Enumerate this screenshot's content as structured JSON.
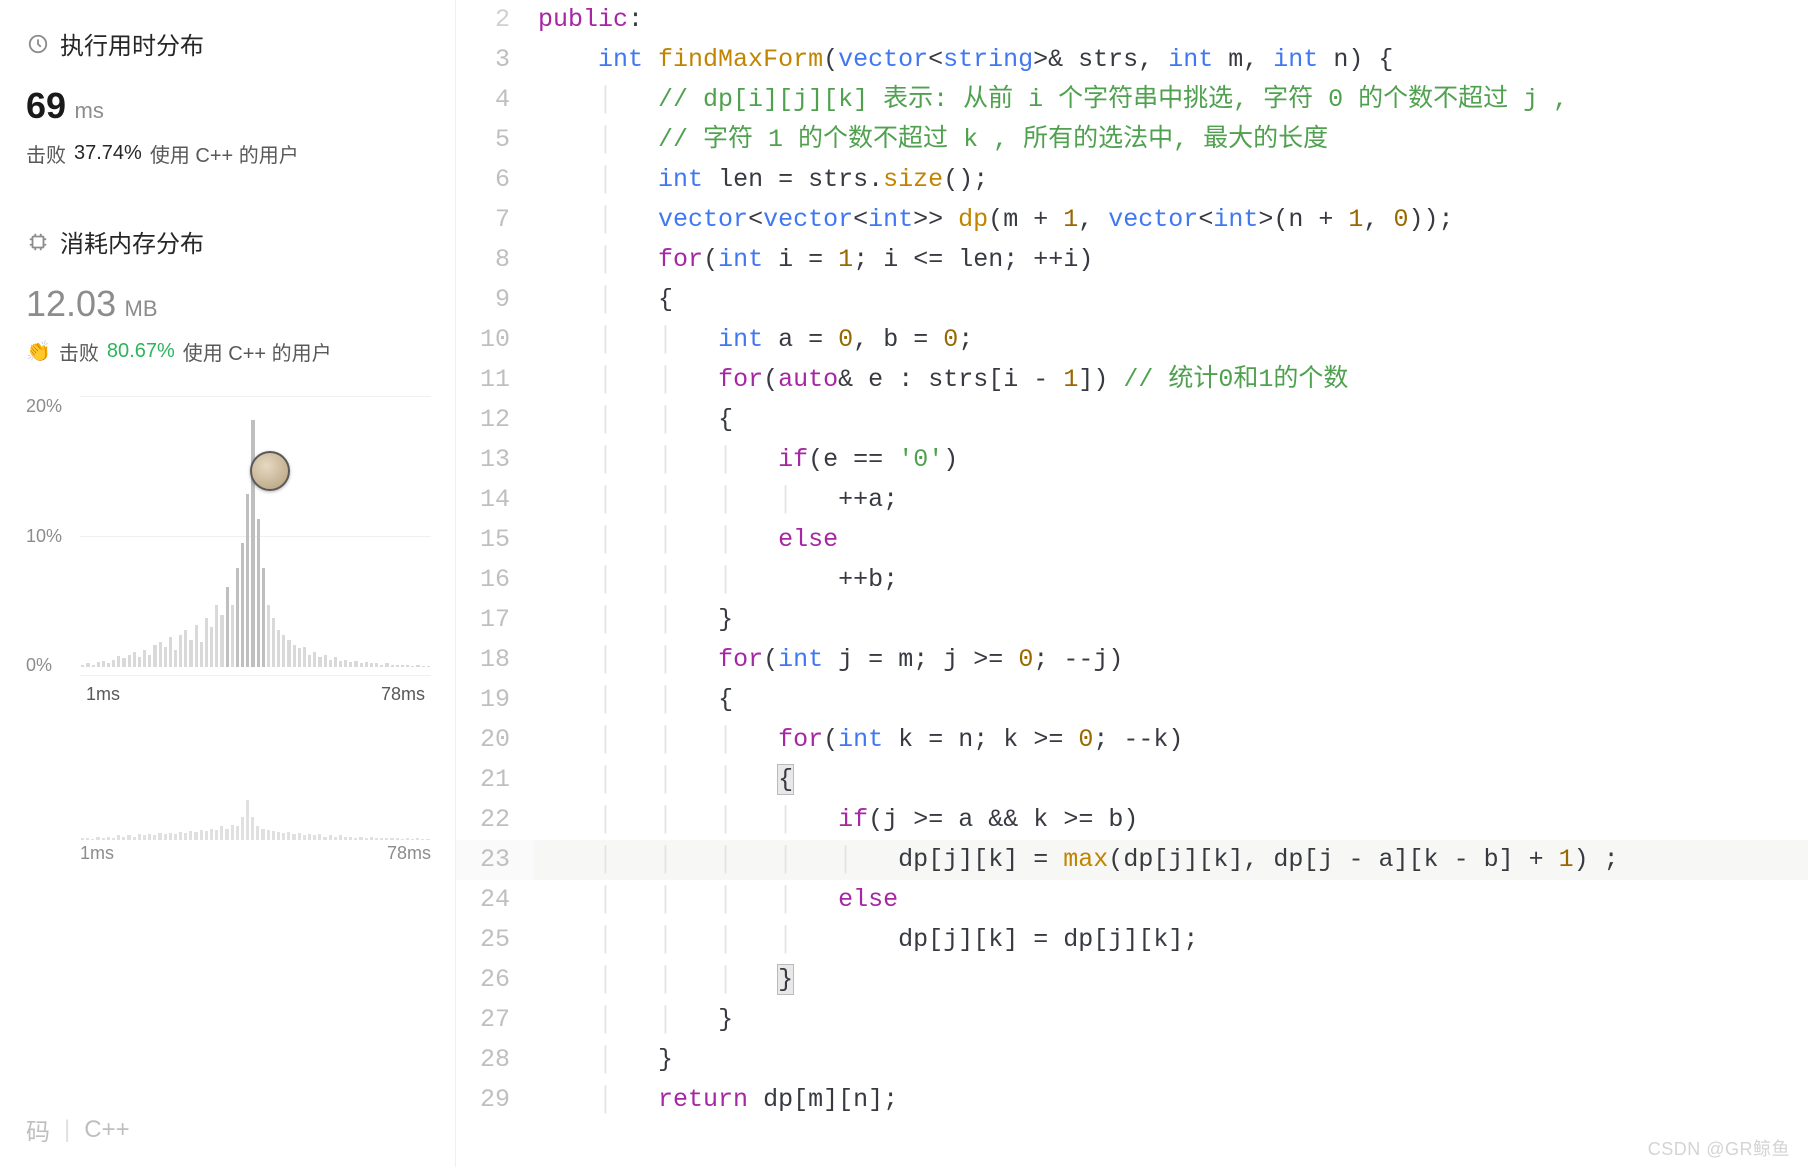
{
  "sidebar": {
    "runtime": {
      "title": "执行用时分布",
      "value": "69",
      "unit": "ms",
      "beat_prefix": "击败",
      "beat_pct": "37.74%",
      "beat_suffix": "使用 C++ 的用户"
    },
    "memory": {
      "title": "消耗内存分布",
      "value": "12.03",
      "unit": "MB",
      "beat_prefix": "击败",
      "beat_pct": "80.67%",
      "beat_suffix": "使用 C++ 的用户"
    },
    "footer": {
      "left": "码",
      "right": "C++"
    }
  },
  "chart_data": {
    "type": "bar",
    "title": "执行用时分布",
    "xlabel": "ms",
    "ylabel": "%",
    "x_ticks": [
      "1ms",
      "78ms"
    ],
    "y_ticks": [
      "20%",
      "10%",
      "0%"
    ],
    "ylim": [
      0,
      22
    ],
    "marker_x": "69ms",
    "values": [
      0.2,
      0.3,
      0.2,
      0.4,
      0.5,
      0.3,
      0.6,
      0.9,
      0.7,
      1.0,
      1.2,
      0.8,
      1.4,
      1.0,
      1.8,
      2.0,
      1.6,
      2.4,
      1.4,
      2.6,
      3.0,
      2.2,
      3.4,
      2.0,
      4.0,
      3.2,
      5.0,
      4.2,
      6.5,
      5.0,
      8.0,
      10.0,
      14.0,
      20.0,
      12.0,
      8.0,
      5.0,
      4.0,
      3.0,
      2.6,
      2.2,
      1.8,
      1.5,
      1.6,
      1.0,
      1.2,
      0.8,
      1.0,
      0.6,
      0.8,
      0.5,
      0.6,
      0.4,
      0.5,
      0.3,
      0.4,
      0.3,
      0.3,
      0.2,
      0.3,
      0.2,
      0.2,
      0.15,
      0.2,
      0.1,
      0.15,
      0.1,
      0.1
    ]
  },
  "mini_chart": {
    "x_ticks": [
      "1ms",
      "78ms"
    ],
    "values": [
      0.2,
      0.2,
      0.1,
      0.3,
      0.2,
      0.3,
      0.2,
      0.4,
      0.3,
      0.4,
      0.3,
      0.5,
      0.4,
      0.5,
      0.4,
      0.6,
      0.5,
      0.6,
      0.5,
      0.7,
      0.6,
      0.8,
      0.7,
      0.9,
      0.8,
      1.0,
      0.9,
      1.2,
      1.0,
      1.3,
      1.2,
      2.0,
      3.5,
      2.0,
      1.2,
      1.0,
      0.9,
      0.8,
      0.7,
      0.6,
      0.7,
      0.5,
      0.6,
      0.4,
      0.5,
      0.4,
      0.5,
      0.3,
      0.4,
      0.3,
      0.4,
      0.3,
      0.3,
      0.2,
      0.3,
      0.2,
      0.3,
      0.2,
      0.2,
      0.2,
      0.2,
      0.2,
      0.1,
      0.2,
      0.1,
      0.2,
      0.1,
      0.1
    ]
  },
  "code": {
    "lines": [
      {
        "n": 2,
        "html": "<span class='tok-kw'>public</span><span class='tok-pun'>:</span>"
      },
      {
        "n": 3,
        "html": "    <span class='tok-type'>int</span> <span class='tok-fn'>findMaxForm</span><span class='tok-pun'>(</span><span class='tok-type'>vector</span><span class='tok-pun'>&lt;</span><span class='tok-type'>string</span><span class='tok-pun'>&gt;&amp;</span> <span class='tok-id'>strs</span><span class='tok-pun'>,</span> <span class='tok-type'>int</span> <span class='tok-id'>m</span><span class='tok-pun'>,</span> <span class='tok-type'>int</span> <span class='tok-id'>n</span><span class='tok-pun'>) {</span>"
      },
      {
        "n": 4,
        "html": "    <span class='indent-guide'>│</span>   <span class='tok-cmt'>// dp[i][j][k] 表示: 从前 i 个字符串中挑选, 字符 0 的个数不超过 j ,</span>"
      },
      {
        "n": 5,
        "html": "    <span class='indent-guide'>│</span>   <span class='tok-cmt'>// 字符 1 的个数不超过 k , 所有的选法中, 最大的长度</span>"
      },
      {
        "n": 6,
        "html": "    <span class='indent-guide'>│</span>   <span class='tok-type'>int</span> <span class='tok-id'>len</span> <span class='tok-pun'>=</span> <span class='tok-id'>strs</span><span class='tok-pun'>.</span><span class='tok-fn'>size</span><span class='tok-pun'>();</span>"
      },
      {
        "n": 7,
        "html": "    <span class='indent-guide'>│</span>   <span class='tok-type'>vector</span><span class='tok-pun'>&lt;</span><span class='tok-type'>vector</span><span class='tok-pun'>&lt;</span><span class='tok-type'>int</span><span class='tok-pun'>&gt;&gt;</span> <span class='tok-fn'>dp</span><span class='tok-pun'>(</span><span class='tok-id'>m</span> <span class='tok-pun'>+</span> <span class='tok-num'>1</span><span class='tok-pun'>,</span> <span class='tok-type'>vector</span><span class='tok-pun'>&lt;</span><span class='tok-type'>int</span><span class='tok-pun'>&gt;(</span><span class='tok-id'>n</span> <span class='tok-pun'>+</span> <span class='tok-num'>1</span><span class='tok-pun'>,</span> <span class='tok-num'>0</span><span class='tok-pun'>));</span>"
      },
      {
        "n": 8,
        "html": "    <span class='indent-guide'>│</span>   <span class='tok-kw'>for</span><span class='tok-pun'>(</span><span class='tok-type'>int</span> <span class='tok-id'>i</span> <span class='tok-pun'>=</span> <span class='tok-num'>1</span><span class='tok-pun'>;</span> <span class='tok-id'>i</span> <span class='tok-pun'>&lt;=</span> <span class='tok-id'>len</span><span class='tok-pun'>; ++</span><span class='tok-id'>i</span><span class='tok-pun'>)</span>"
      },
      {
        "n": 9,
        "html": "    <span class='indent-guide'>│</span>   <span class='tok-pun'>{</span>"
      },
      {
        "n": 10,
        "html": "    <span class='indent-guide'>│</span>   <span class='indent-guide'>│</span>   <span class='tok-type'>int</span> <span class='tok-id'>a</span> <span class='tok-pun'>=</span> <span class='tok-num'>0</span><span class='tok-pun'>,</span> <span class='tok-id'>b</span> <span class='tok-pun'>=</span> <span class='tok-num'>0</span><span class='tok-pun'>;</span>"
      },
      {
        "n": 11,
        "html": "    <span class='indent-guide'>│</span>   <span class='indent-guide'>│</span>   <span class='tok-kw'>for</span><span class='tok-pun'>(</span><span class='tok-kw'>auto</span><span class='tok-pun'>&amp;</span> <span class='tok-id'>e</span> <span class='tok-pun'>:</span> <span class='tok-id'>strs</span><span class='tok-pun'>[</span><span class='tok-id'>i</span> <span class='tok-pun'>-</span> <span class='tok-num'>1</span><span class='tok-pun'>])</span> <span class='tok-cmt'>// 统计0和1的个数</span>"
      },
      {
        "n": 12,
        "html": "    <span class='indent-guide'>│</span>   <span class='indent-guide'>│</span>   <span class='tok-pun'>{</span>"
      },
      {
        "n": 13,
        "html": "    <span class='indent-guide'>│</span>   <span class='indent-guide'>│</span>   <span class='indent-guide'>│</span>   <span class='tok-kw'>if</span><span class='tok-pun'>(</span><span class='tok-id'>e</span> <span class='tok-pun'>==</span> <span class='tok-str'>'0'</span><span class='tok-pun'>)</span>"
      },
      {
        "n": 14,
        "html": "    <span class='indent-guide'>│</span>   <span class='indent-guide'>│</span>   <span class='indent-guide'>│</span>   <span class='indent-guide'>│</span>   <span class='tok-pun'>++</span><span class='tok-id'>a</span><span class='tok-pun'>;</span>"
      },
      {
        "n": 15,
        "html": "    <span class='indent-guide'>│</span>   <span class='indent-guide'>│</span>   <span class='indent-guide'>│</span>   <span class='tok-kw'>else</span>"
      },
      {
        "n": 16,
        "html": "    <span class='indent-guide'>│</span>   <span class='indent-guide'>│</span>   <span class='indent-guide'>│</span>       <span class='tok-pun'>++</span><span class='tok-id'>b</span><span class='tok-pun'>;</span>"
      },
      {
        "n": 17,
        "html": "    <span class='indent-guide'>│</span>   <span class='indent-guide'>│</span>   <span class='tok-pun'>}</span>"
      },
      {
        "n": 18,
        "html": "    <span class='indent-guide'>│</span>   <span class='indent-guide'>│</span>   <span class='tok-kw'>for</span><span class='tok-pun'>(</span><span class='tok-type'>int</span> <span class='tok-id'>j</span> <span class='tok-pun'>=</span> <span class='tok-id'>m</span><span class='tok-pun'>;</span> <span class='tok-id'>j</span> <span class='tok-pun'>&gt;=</span> <span class='tok-num'>0</span><span class='tok-pun'>; --</span><span class='tok-id'>j</span><span class='tok-pun'>)</span>"
      },
      {
        "n": 19,
        "html": "    <span class='indent-guide'>│</span>   <span class='indent-guide'>│</span>   <span class='tok-pun'>{</span>"
      },
      {
        "n": 20,
        "html": "    <span class='indent-guide'>│</span>   <span class='indent-guide'>│</span>   <span class='indent-guide'>│</span>   <span class='tok-kw'>for</span><span class='tok-pun'>(</span><span class='tok-type'>int</span> <span class='tok-id'>k</span> <span class='tok-pun'>=</span> <span class='tok-id'>n</span><span class='tok-pun'>;</span> <span class='tok-id'>k</span> <span class='tok-pun'>&gt;=</span> <span class='tok-num'>0</span><span class='tok-pun'>; --</span><span class='tok-id'>k</span><span class='tok-pun'>)</span>"
      },
      {
        "n": 21,
        "html": "    <span class='indent-guide'>│</span>   <span class='indent-guide'>│</span>   <span class='indent-guide'>│</span>   <span class='tok-pun bracket-hl'>{</span>"
      },
      {
        "n": 22,
        "html": "    <span class='indent-guide'>│</span>   <span class='indent-guide'>│</span>   <span class='indent-guide'>│</span>   <span class='indent-guide'>│</span>   <span class='tok-kw'>if</span><span class='tok-pun'>(</span><span class='tok-id'>j</span> <span class='tok-pun'>&gt;=</span> <span class='tok-id'>a</span> <span class='tok-pun'>&amp;&amp;</span> <span class='tok-id'>k</span> <span class='tok-pun'>&gt;=</span> <span class='tok-id'>b</span><span class='tok-pun'>)</span>"
      },
      {
        "n": 23,
        "hl": true,
        "html": "    <span class='indent-guide'>│</span>   <span class='indent-guide'>│</span>   <span class='indent-guide'>│</span>   <span class='indent-guide'>│</span>   <span class='indent-guide'>│</span>   <span class='tok-id'>dp</span><span class='tok-pun'>[</span><span class='tok-id'>j</span><span class='tok-pun'>][</span><span class='tok-id'>k</span><span class='tok-pun'>] =</span> <span class='tok-fn'>max</span><span class='tok-pun'>(</span><span class='tok-id'>dp</span><span class='tok-pun'>[</span><span class='tok-id'>j</span><span class='tok-pun'>][</span><span class='tok-id'>k</span><span class='tok-pun'>],</span> <span class='tok-id'>dp</span><span class='tok-pun'>[</span><span class='tok-id'>j</span> <span class='tok-pun'>-</span> <span class='tok-id'>a</span><span class='tok-pun'>][</span><span class='tok-id'>k</span> <span class='tok-pun'>-</span> <span class='tok-id'>b</span><span class='tok-pun'>] +</span> <span class='tok-num'>1</span><span class='tok-pun'>) ;</span>"
      },
      {
        "n": 24,
        "html": "    <span class='indent-guide'>│</span>   <span class='indent-guide'>│</span>   <span class='indent-guide'>│</span>   <span class='indent-guide'>│</span>   <span class='tok-kw'>else</span>"
      },
      {
        "n": 25,
        "html": "    <span class='indent-guide'>│</span>   <span class='indent-guide'>│</span>   <span class='indent-guide'>│</span>   <span class='indent-guide'>│</span>       <span class='tok-id'>dp</span><span class='tok-pun'>[</span><span class='tok-id'>j</span><span class='tok-pun'>][</span><span class='tok-id'>k</span><span class='tok-pun'>] =</span> <span class='tok-id'>dp</span><span class='tok-pun'>[</span><span class='tok-id'>j</span><span class='tok-pun'>][</span><span class='tok-id'>k</span><span class='tok-pun'>];</span>"
      },
      {
        "n": 26,
        "html": "    <span class='indent-guide'>│</span>   <span class='indent-guide'>│</span>   <span class='indent-guide'>│</span>   <span class='tok-pun bracket-hl'>}</span>"
      },
      {
        "n": 27,
        "html": "    <span class='indent-guide'>│</span>   <span class='indent-guide'>│</span>   <span class='tok-pun'>}</span>"
      },
      {
        "n": 28,
        "html": "    <span class='indent-guide'>│</span>   <span class='tok-pun'>}</span>"
      },
      {
        "n": 29,
        "html": "    <span class='indent-guide'>│</span>   <span class='tok-kw'>return</span> <span class='tok-id'>dp</span><span class='tok-pun'>[</span><span class='tok-id'>m</span><span class='tok-pun'>][</span><span class='tok-id'>n</span><span class='tok-pun'>];</span>"
      }
    ]
  },
  "watermark": "CSDN @GR鲸鱼"
}
